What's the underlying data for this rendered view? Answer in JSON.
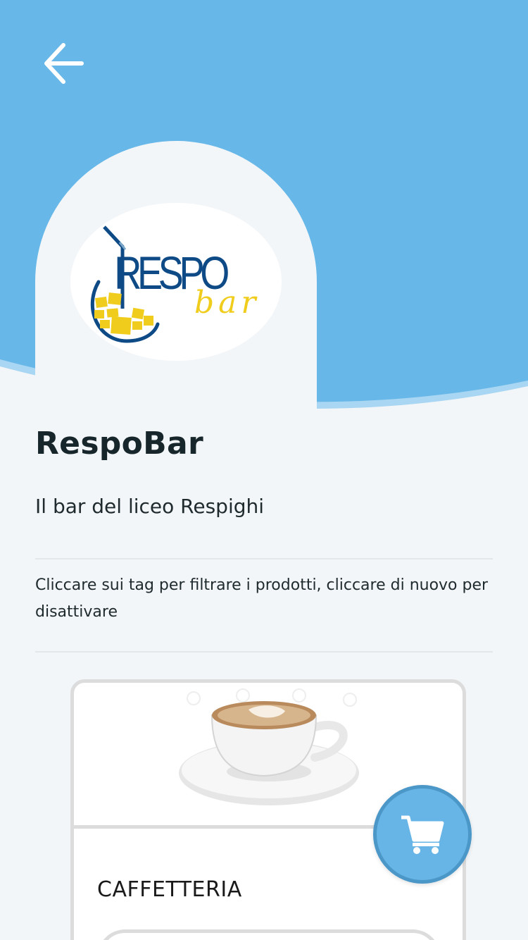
{
  "colors": {
    "hero_blue": "#67b8e8",
    "background": "#f3f6f9",
    "fab_blue": "#67b5e6",
    "logo_navy": "#0e4a86",
    "logo_yellow": "#f0cd1d"
  },
  "header": {
    "back_icon": "arrow-left-icon"
  },
  "logo": {
    "text_main": "RESPO",
    "text_sub": "bar"
  },
  "store": {
    "name": "RespoBar",
    "description": "Il bar del liceo Respighi"
  },
  "hint": "Cliccare sui tag per filtrare i prodotti, cliccare di nuovo per disattivare",
  "categories": [
    {
      "title": "CAFFETTERIA",
      "image": "cappuccino-cup"
    }
  ],
  "cart": {
    "icon": "cart-icon"
  }
}
